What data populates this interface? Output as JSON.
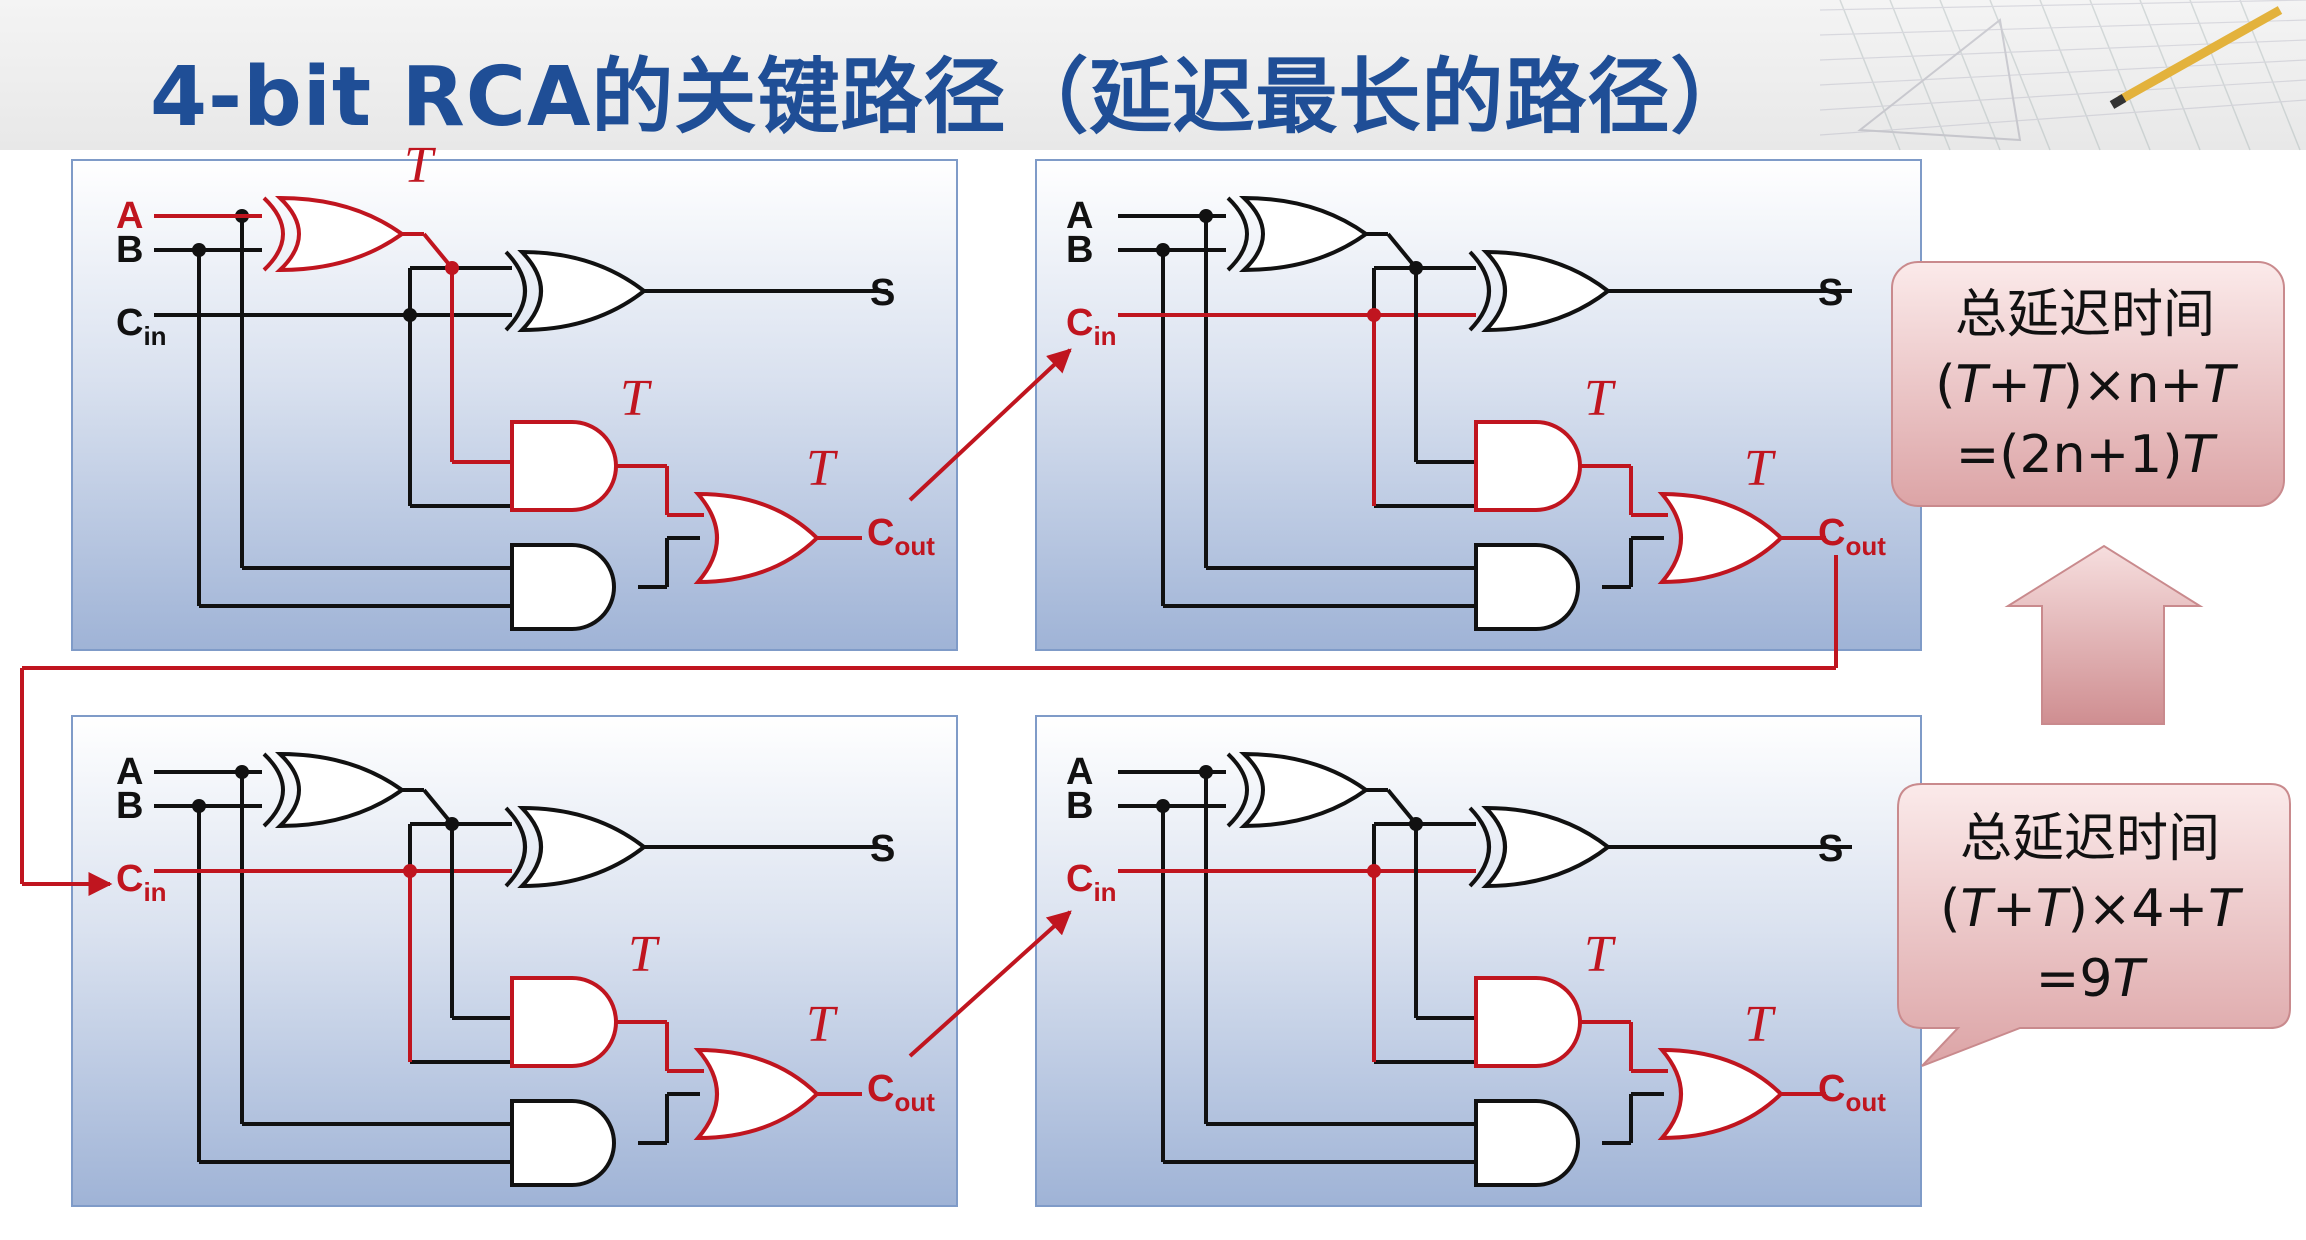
{
  "title": "4-bit RCA的关键路径（延迟最长的路径）",
  "colors": {
    "title": "#1f4e96",
    "critical": "#c0151f",
    "wire": "#111111",
    "panel_top": "#ffffff",
    "panel_bottom": "#9fb3d6",
    "callout": "#e7b3b3"
  },
  "adders": [
    {
      "a": "A",
      "b": "B",
      "cin": "C",
      "cin_sub": "in",
      "s": "S",
      "cout": "C",
      "cout_sub": "out",
      "t_labels": [
        "T",
        "T",
        "T"
      ]
    },
    {
      "a": "A",
      "b": "B",
      "cin": "C",
      "cin_sub": "in",
      "s": "S",
      "cout": "C",
      "cout_sub": "out",
      "t_labels": [
        "T",
        "T"
      ]
    },
    {
      "a": "A",
      "b": "B",
      "cin": "C",
      "cin_sub": "in",
      "s": "S",
      "cout": "C",
      "cout_sub": "out",
      "t_labels": [
        "T",
        "T"
      ]
    },
    {
      "a": "A",
      "b": "B",
      "cin": "C",
      "cin_sub": "in",
      "s": "S",
      "cout": "C",
      "cout_sub": "out",
      "t_labels": [
        "T",
        "T"
      ]
    }
  ],
  "callout_general": {
    "line1": "总延迟时间",
    "line2_a": "(",
    "line2_t1": "T",
    "line2_plus": "+",
    "line2_t2": "T",
    "line2_b": ")×n+",
    "line2_t3": "T",
    "line3_a": "=(2n+1)",
    "line3_t": "T"
  },
  "callout_specific": {
    "line1": "总延迟时间",
    "line2_a": "(",
    "line2_t1": "T",
    "line2_plus": "+",
    "line2_t2": "T",
    "line2_b": ")×4+",
    "line2_t3": "T",
    "line3_a": "=9",
    "line3_t": "T"
  },
  "icons": {
    "decoration": "drafting-tools-sketch-icon",
    "arrow": "up-arrow-icon"
  }
}
